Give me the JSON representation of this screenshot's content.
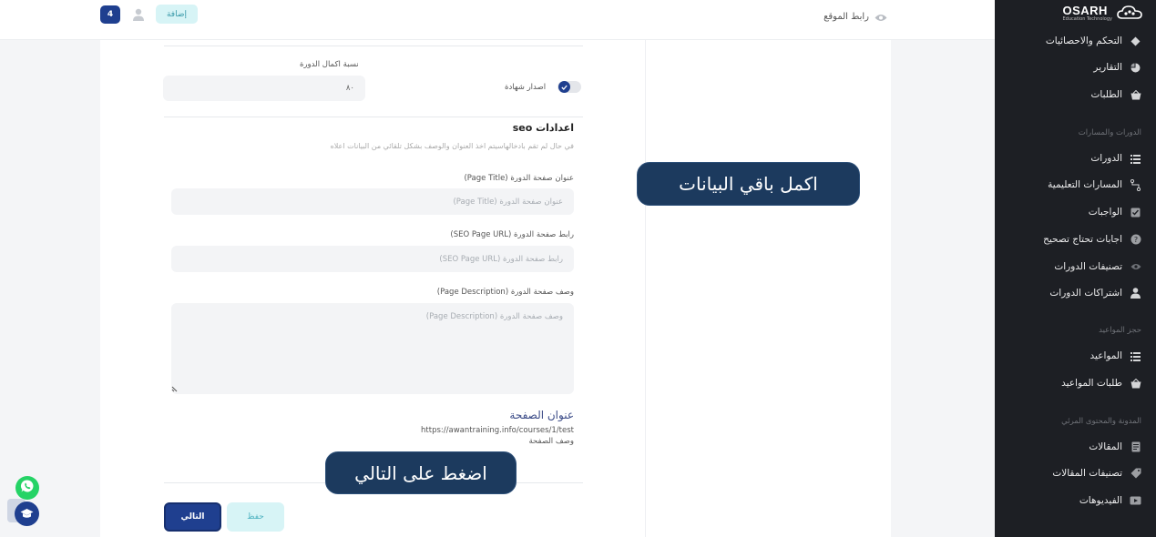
{
  "brand": {
    "name": "OSARH",
    "subtitle": "Education Technology"
  },
  "sidebar": {
    "items": [
      {
        "label": "التحكم والاحصائيات",
        "icon": "diamond-icon"
      },
      {
        "label": "التقارير",
        "icon": "pie-chart-icon"
      },
      {
        "label": "الطلبات",
        "icon": "basket-icon"
      }
    ],
    "section_courses": "الدورات والمسارات",
    "course_items": [
      {
        "label": "الدورات",
        "icon": "list-icon"
      },
      {
        "label": "المسارات التعليمية",
        "icon": "route-icon"
      },
      {
        "label": "الواجبات",
        "icon": "checkbox-icon"
      },
      {
        "label": "اجابات تحتاج تصحيح",
        "icon": "question-icon"
      },
      {
        "label": "تصنيفات الدورات",
        "icon": "eye-icon"
      },
      {
        "label": "اشتراكات الدورات",
        "icon": "user-icon"
      }
    ],
    "section_booking": "حجز المواعيد",
    "booking_items": [
      {
        "label": "المواعيد",
        "icon": "list-icon"
      },
      {
        "label": "طلبات المواعيد",
        "icon": "basket-icon"
      }
    ],
    "section_blog": "المدونة والمحتوى المرئي",
    "blog_items": [
      {
        "label": "المقالات",
        "icon": "document-icon"
      },
      {
        "label": "تصنيفات المقالات",
        "icon": "tag-icon"
      },
      {
        "label": "الفيديوهات",
        "icon": "video-icon"
      }
    ]
  },
  "topbar": {
    "site_link": "رابط الموقع",
    "notification_count": "4",
    "add_label": "إضافة"
  },
  "form": {
    "completion_label": "نسبة اكمال الدورة",
    "completion_value": "٨٠",
    "certificate_label": "اصدار شهادة",
    "seo_title": "اعدادات seo",
    "seo_note": "في حال لم تقم بادخالهاسيتم اخذ العنوان والوصف بشكل تلقائي من البيانات اعلاه",
    "page_title_label": "عنوان صفحة الدورة (Page Title)",
    "page_title_placeholder": "عنوان صفحة الدورة (Page Title)",
    "page_url_label": "رابط صفحة الدورة (SEO Page URL)",
    "page_url_placeholder": "رابط صفحة الدورة (SEO Page URL)",
    "page_desc_label": "وصف صفحة الدورة (Page Description)",
    "page_desc_placeholder": "وصف صفحة الدورة (Page Description)"
  },
  "preview": {
    "title": "عنوان الصفحة",
    "url": "https://awantraining.info/courses/1/test",
    "description": "وصف الصفحة"
  },
  "buttons": {
    "next": "التالي",
    "save": "حفظ"
  },
  "callouts": {
    "complete_data": "اكمل باقي البيانات",
    "press_next": "اضغط على التالي"
  },
  "colors": {
    "sidebar_bg": "#1d1f24",
    "primary": "#1f3f8f",
    "accent_light": "#d7f4f6",
    "callout_bg": "#1c3a5e",
    "whatsapp": "#25d366"
  }
}
